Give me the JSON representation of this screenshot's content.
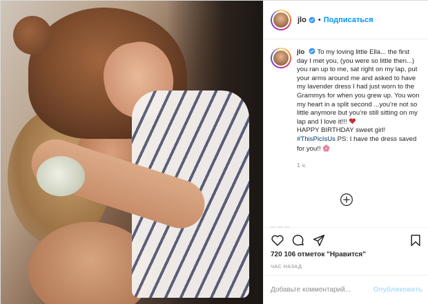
{
  "post": {
    "username": "jlo",
    "separator": "•",
    "follow_label": "Подписаться"
  },
  "caption": {
    "username": "jlo",
    "text": "To my loving little Ella... the first day I met you, (you were so little then...) you ran up to me, sat right on my lap, put your arms around me and asked to have my lavender dress I had just worn to the Grammys for when you grew up. You won my heart in a split second ...you’re not so little anymore but you’re still sitting on my lap and I love it!!! ",
    "line2": "HAPPY BIRTHDAY sweet girl!",
    "hashtag": "#ThisPicIsUs",
    "line3": " PS: I have the dress saved for you!! ",
    "time": "1 ч."
  },
  "peek_text": "... ... ...",
  "icons": {
    "verified": "verified-badge-icon",
    "heart_emoji": "heart-emoji-icon",
    "flower_emoji": "flower-emoji-icon",
    "load_more": "plus-circle-icon",
    "like": "heart-icon",
    "comment": "comment-icon",
    "share": "share-icon",
    "save": "bookmark-icon"
  },
  "colors": {
    "link": "#0095f6",
    "hashtag": "#00376b",
    "muted": "#8e8e8e"
  },
  "stats": {
    "likes": "720 106 отметок \"Нравится\"",
    "time_ago": "ЧАС НАЗАД"
  },
  "comment": {
    "placeholder": "Добавьте комментарий...",
    "post_label": "Опубликовать"
  }
}
